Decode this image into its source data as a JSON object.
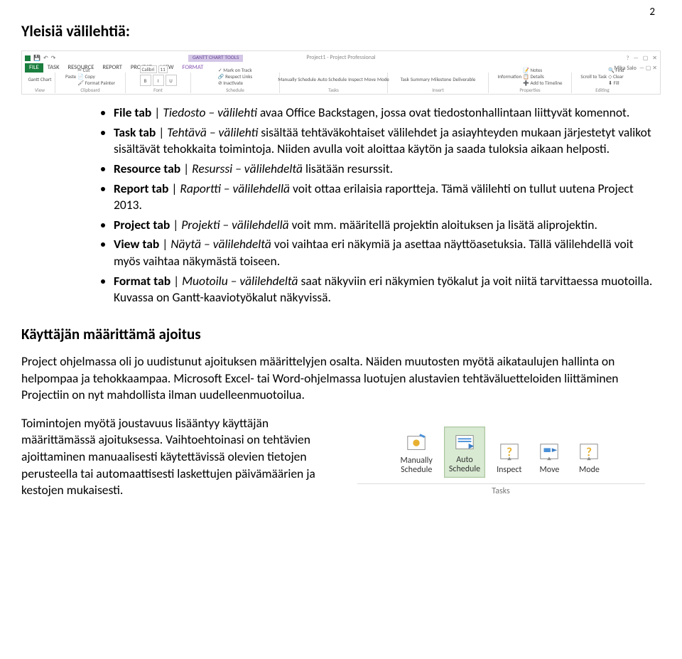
{
  "page_number": "2",
  "heading1": "Yleisiä välilehtiä:",
  "heading2": "Käyttäjän määrittämä ajoitus",
  "ribbon": {
    "title": "Project1 - Project Professional",
    "qat": {
      "save": "💾",
      "undo": "↶",
      "redo": "↷"
    },
    "context_tool": "GANTT CHART TOOLS",
    "tabs": [
      "FILE",
      "TASK",
      "RESOURCE",
      "REPORT",
      "PROJECT",
      "VIEW",
      "FORMAT"
    ],
    "user": "Mika Salo",
    "help": "?",
    "groups": {
      "view": {
        "label": "View",
        "gantt": "Gantt\nChart"
      },
      "clipboard": {
        "label": "Clipboard",
        "paste": "Paste",
        "cut": "✂ Cut",
        "copy": "📄 Copy",
        "painter": "🖌 Format Painter"
      },
      "font": {
        "label": "Font",
        "name": "Calibri",
        "size": "11",
        "b": "B",
        "i": "I",
        "u": "U"
      },
      "schedule": {
        "label": "Schedule",
        "track": "✓ Mark on Track",
        "links": "🔗 Respect Links",
        "inact": "⊘ Inactivate"
      },
      "tasks": {
        "label": "Tasks",
        "manual": "Manually\nSchedule",
        "auto": "Auto\nSchedule",
        "inspect": "Inspect",
        "move": "Move",
        "mode": "Mode"
      },
      "insert": {
        "label": "Insert",
        "task": "Task",
        "summary": "Summary",
        "milestone": "Milestone",
        "deliverable": "Deliverable"
      },
      "properties": {
        "label": "Properties",
        "info": "Information",
        "notes": "📝 Notes",
        "details": "📋 Details",
        "timeline": "➕ Add to Timeline"
      },
      "editing": {
        "label": "Editing",
        "scroll": "Scroll\nto Task",
        "find": "🔍 Find",
        "clear": "◇ Clear",
        "fill": "⬇ Fill"
      }
    }
  },
  "bullets": [
    {
      "t": "File tab",
      "s": " | ",
      "i": "Tiedosto – välilehti",
      "r": " avaa Office Backstagen, jossa ovat tiedostonhallintaan liittyvät komennot."
    },
    {
      "t": "Task tab",
      "s": " | ",
      "i": "Tehtävä – välilehti",
      "r": " sisältää tehtäväkohtaiset välilehdet ja asiayhteyden mukaan järjestetyt valikot sisältävät tehokkaita toimintoja. Niiden avulla voit aloittaa käytön ja saada tuloksia aikaan helposti."
    },
    {
      "t": "Resource tab",
      "s": " | ",
      "i": "Resurssi – välilehdeltä",
      "r": " lisätään resurssit."
    },
    {
      "t": "Report tab",
      "s": " | ",
      "i": "Raportti – välilehdellä",
      "r": " voit ottaa erilaisia raportteja. Tämä välilehti on tullut uutena Project 2013."
    },
    {
      "t": "Project tab",
      "s": " | ",
      "i": "Projekti – välilehdellä",
      "r": " voit mm. määritellä projektin aloituksen ja lisätä aliprojektin."
    },
    {
      "t": "View tab",
      "s": " | ",
      "i": "Näytä – välilehdeltä",
      "r": " voi vaihtaa eri näkymiä ja asettaa näyttöasetuksia. Tällä välilehdellä voit myös vaihtaa näkymästä toiseen."
    },
    {
      "t": "Format tab",
      "s": " | ",
      "i": "Muotoilu – välilehdeltä",
      "r": " saat näkyviin eri näkymien työkalut ja voit niitä tarvittaessa muotoilla. Kuvassa on Gantt-kaaviotyökalut näkyvissä."
    }
  ],
  "para_intro": "Project ohjelmassa oli jo uudistunut ajoituksen määrittelyjen osalta. Näiden muutosten myötä aikataulujen hallinta on helpompaa ja tehokkaampaa. Microsoft Excel- tai Word-ohjelmassa luotujen alustavien tehtäväluetteloiden liittäminen Projectiin on nyt mahdollista ilman uudelleenmuotoilua.",
  "para_side": "Toimintojen myötä joustavuus lisääntyy käyttäjän määrittämässä ajoituksessa. Vaihtoehtoinasi on tehtävien ajoittaminen manuaalisesti käytettävissä olevien tietojen perusteella tai automaattisesti laskettujen päivämäärien ja kestojen mukaisesti.",
  "tasks_panel": {
    "group_label": "Tasks",
    "buttons": [
      {
        "label": "Manually\nSchedule",
        "on": false,
        "key": "manual"
      },
      {
        "label": "Auto\nSchedule",
        "on": true,
        "key": "auto"
      },
      {
        "label": "Inspect",
        "on": false,
        "key": "inspect"
      },
      {
        "label": "Move",
        "on": false,
        "key": "move"
      },
      {
        "label": "Mode",
        "on": false,
        "key": "mode"
      }
    ]
  }
}
